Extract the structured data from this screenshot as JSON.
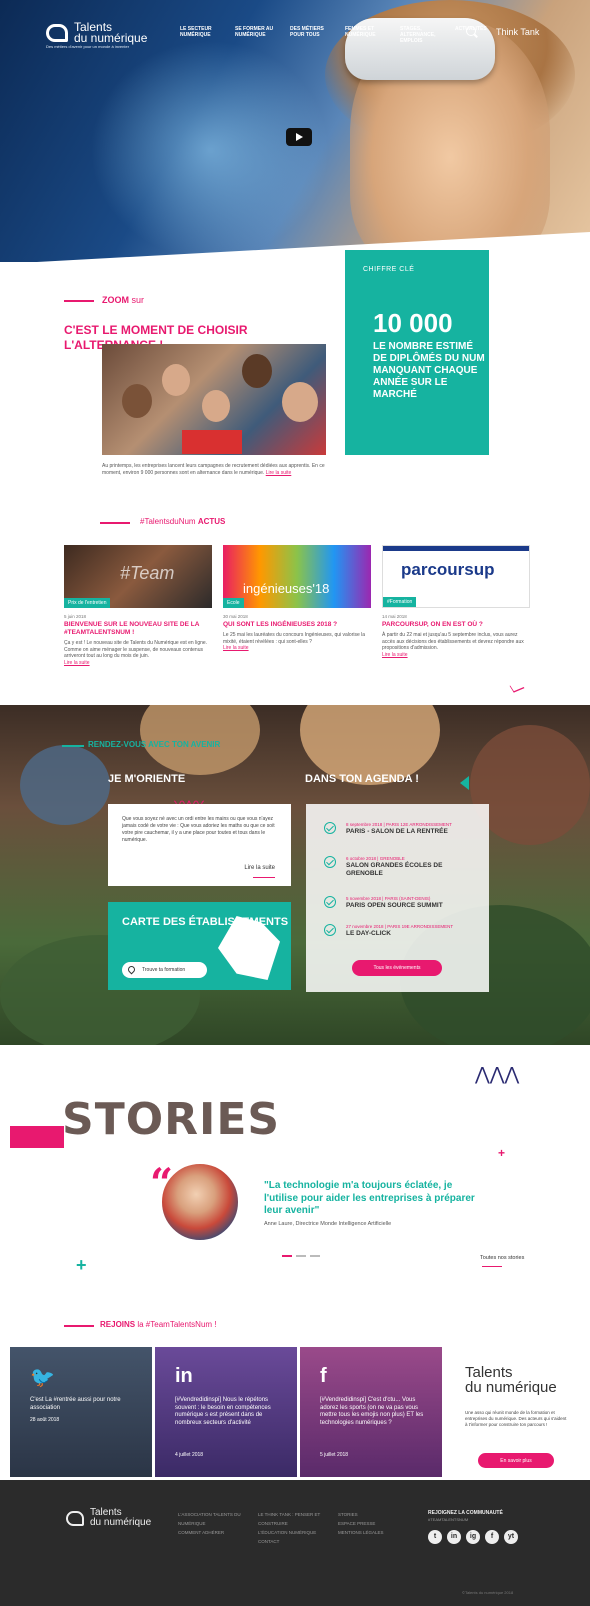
{
  "header": {
    "logo_line1": "Talents",
    "logo_line2": "du numérique",
    "tagline": "Des métiers d'avenir pour un monde à inventer",
    "nav": [
      "Le secteur numérique",
      "Se former au numérique",
      "Des métiers pour tous",
      "Femmes et numérique",
      "Stages, alternance, emplois",
      "Actualités"
    ],
    "think_tank": "Think Tank"
  },
  "zoom": {
    "label": "ZOOM",
    "label_suffix": "sur",
    "title": "C'EST LE MOMENT DE CHOISIR L'ALTERNANCE !",
    "text": "Au printemps, les entreprises lancent leurs campagnes de recrutement dédiées aux apprentis. En ce moment, environ 9 000 personnes sont en alternance dans le numérique.",
    "more": "Lire la suite"
  },
  "key_figure": {
    "label": "CHIFFRE CLÉ",
    "number": "10 000",
    "description": "LE NOMBRE ESTIMÉ DE DIPLÔMÉS DU NUM MANQUANT CHAQUE ANNÉE SUR LE MARCHÉ"
  },
  "actus": {
    "hashtag": "#TalentsduNum",
    "label": "ACTUS",
    "cards": [
      {
        "tag": "Prix de l'entretien",
        "date": "5 juin 2018",
        "title": "BIENVENUE SUR LE NOUVEAU SITE DE LA #TEAMTALENTSNUM !",
        "body": "Ça y est ! Le nouveau site de Talents du Numérique est en ligne. Comme on aime ménager le suspense, de nouveaux contenus arriveront tout au long du mois de juin.",
        "more": "Lire la suite"
      },
      {
        "tag": "Ecole",
        "date": "30 mai 2018",
        "title": "QUI SONT LES INGÉNIEUSES 2018 ?",
        "body": "Le 25 mai les lauréates du concours Ingénieuses, qui valorise la mixité, étaient révélées : qui sont-elles ?",
        "more": "Lire la suite"
      },
      {
        "tag": "#Formation",
        "date": "14 mai 2018",
        "title": "PARCOURSUP, ON EN EST OÙ ?",
        "body": "À partir du 22 mai et jusqu'au 5 septembre inclus, vous aurez accès aux décisions des établissements et devrez répondre aux propositions d'admission.",
        "more": "Lire la suite"
      }
    ],
    "image_texts": [
      "#Team",
      "ingénieuses'18",
      "parcoursup"
    ]
  },
  "avenir": {
    "tag": "RENDEZ-VOUS AVEC TON AVENIR",
    "orient_title": "JE M'ORIENTE",
    "orient_text": "Que vous soyez né avec un ordi entre les mains ou que vous n'ayez jamais codé de votre vie : Que vous adoriez les maths ou que ce soit votre pire cauchemar, il y a une place pour toutes et tous dans le numérique.",
    "orient_more": "Lire la suite",
    "carte_title": "CARTE DES ÉTABLISSEMENTS",
    "carte_button": "Trouve ta formation",
    "agenda_title": "DANS TON AGENDA !",
    "events": [
      {
        "date": "8 septembre 2018  |  PARIS 12E ARRONDISSEMENT",
        "name": "PARIS - SALON DE LA RENTRÉE"
      },
      {
        "date": "6 octobre 2018  |  GRENOBLE",
        "name": "SALON GRANDES ÉCOLES DE GRENOBLE"
      },
      {
        "date": "5 novembre 2018  |  PARIS (SAINT-DENIS)",
        "name": "PARIS OPEN SOURCE SUMMIT"
      },
      {
        "date": "27 novembre 2018  |  PARIS 19E ARRONDISSEMENT",
        "name": "LE DAY-CLICK"
      }
    ],
    "agenda_button": "Tous les événements"
  },
  "stories": {
    "title": "STORIES",
    "quote": "\"La technologie m'a toujours éclatée, je l'utilise pour aider les entreprises à préparer leur avenir\"",
    "author": "Anne Laure, Directrice Monde Intelligence Artificielle",
    "all": "Toutes nos stories"
  },
  "rejoins": {
    "label": "REJOINS",
    "hashtag": "la #TeamTalentsNum !",
    "posts": [
      {
        "icon": "twitter-icon",
        "text": "C'est La #rentrée aussi pour notre association",
        "date": "28 août 2018",
        "bg": "#3a4f6b"
      },
      {
        "icon": "linkedin-icon",
        "text": "[#Vendredidinspi] Nous le répétons souvent : le besoin en compétences numérique s est présent dans de nombreux secteurs d'activité",
        "date": "4 juillet 2018",
        "bg": "#5b3f88"
      },
      {
        "icon": "facebook-icon",
        "text": "[#Vendredidinspi] C'est d'ctu... Vous adorez les sports (on ne va pas vous mettre tous les emojis non plus) ET les technologies numériques ?",
        "date": "5 juillet 2018",
        "bg": "#8a3a7b"
      }
    ],
    "brand_line1": "Talents",
    "brand_line2": "du numérique",
    "brand_desc": "Une asso qui réunit monde de la formation et entreprises du numérique. Des acteurs qui s'aident à t'informer pour construire ton parcours !",
    "brand_button": "En savoir plus"
  },
  "footer": {
    "col1": [
      "L'ASSOCIATION TALENTS DU NUMÉRIQUE",
      "",
      "COMMENT ADHÉRER"
    ],
    "col2": [
      "LE THINK TANK : PENSER ET CONSTRUIRE",
      "L'ÉDUCATION NUMÉRIQUE",
      "CONTACT"
    ],
    "col3": [
      "STORIES",
      "ESPACE PRESSE",
      "MENTIONS LÉGALES"
    ],
    "join": "REJOIGNEZ LA COMMUNAUTÉ",
    "hashtag": "#TEAMTALENTSNUM",
    "social": [
      "t",
      "in",
      "ig",
      "f",
      "yt"
    ],
    "copyright": "©Talents du numérique 2018"
  },
  "colors": {
    "pink": "#e8196f",
    "teal": "#16b3a0",
    "dark": "#2b2b2b"
  }
}
